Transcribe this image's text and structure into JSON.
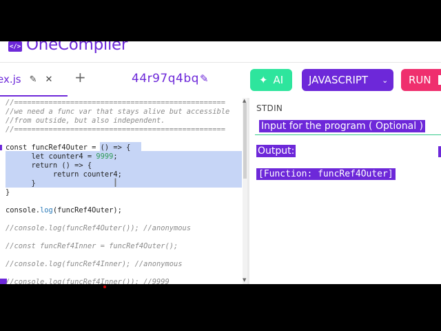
{
  "header": {
    "logo_mark": "</>",
    "logo_text": "OneCompiler"
  },
  "tab": {
    "file_name": "ex.js",
    "edit_icon": "pencil-icon",
    "close_icon": "close-icon",
    "add_icon": "plus-icon"
  },
  "project": {
    "id": "44r97q4bq",
    "edit_icon": "pencil-icon"
  },
  "buttons": {
    "ai": "AI",
    "ai_icon": "sparkle-icon",
    "language": "JAVASCRIPT",
    "language_icon": "chevron-down-icon",
    "run": "RUN"
  },
  "colors": {
    "brand": "#6d28d9",
    "ai": "#2ee59d",
    "run": "#ef2f6e",
    "selection": "#c6d5f6"
  },
  "code": [
    "//=================================================",
    "//we need a func var that stays alive but accessible",
    "//from outside, but also independent.",
    "//=================================================",
    "",
    "const funcRef4Outer = () => {",
    "      let counter4 = 9999;",
    "      return () => {",
    "           return counter4;",
    "      }",
    "}",
    "",
    "console.log(funcRef4Outer);",
    "",
    "//console.log(funcRef4Outer()); //anonymous",
    "",
    "//const funcRef4Inner = funcRef4Outer();",
    "",
    "//console.log(funcRef4Inner); //anonymous",
    "",
    "//console.log(funcRef4Inner()); //9999"
  ],
  "stdin": {
    "label": "STDIN",
    "placeholder": "Input for the program ( Optional )"
  },
  "output": {
    "label": "Output:",
    "text": "[Function: funcRef4Outer]"
  }
}
